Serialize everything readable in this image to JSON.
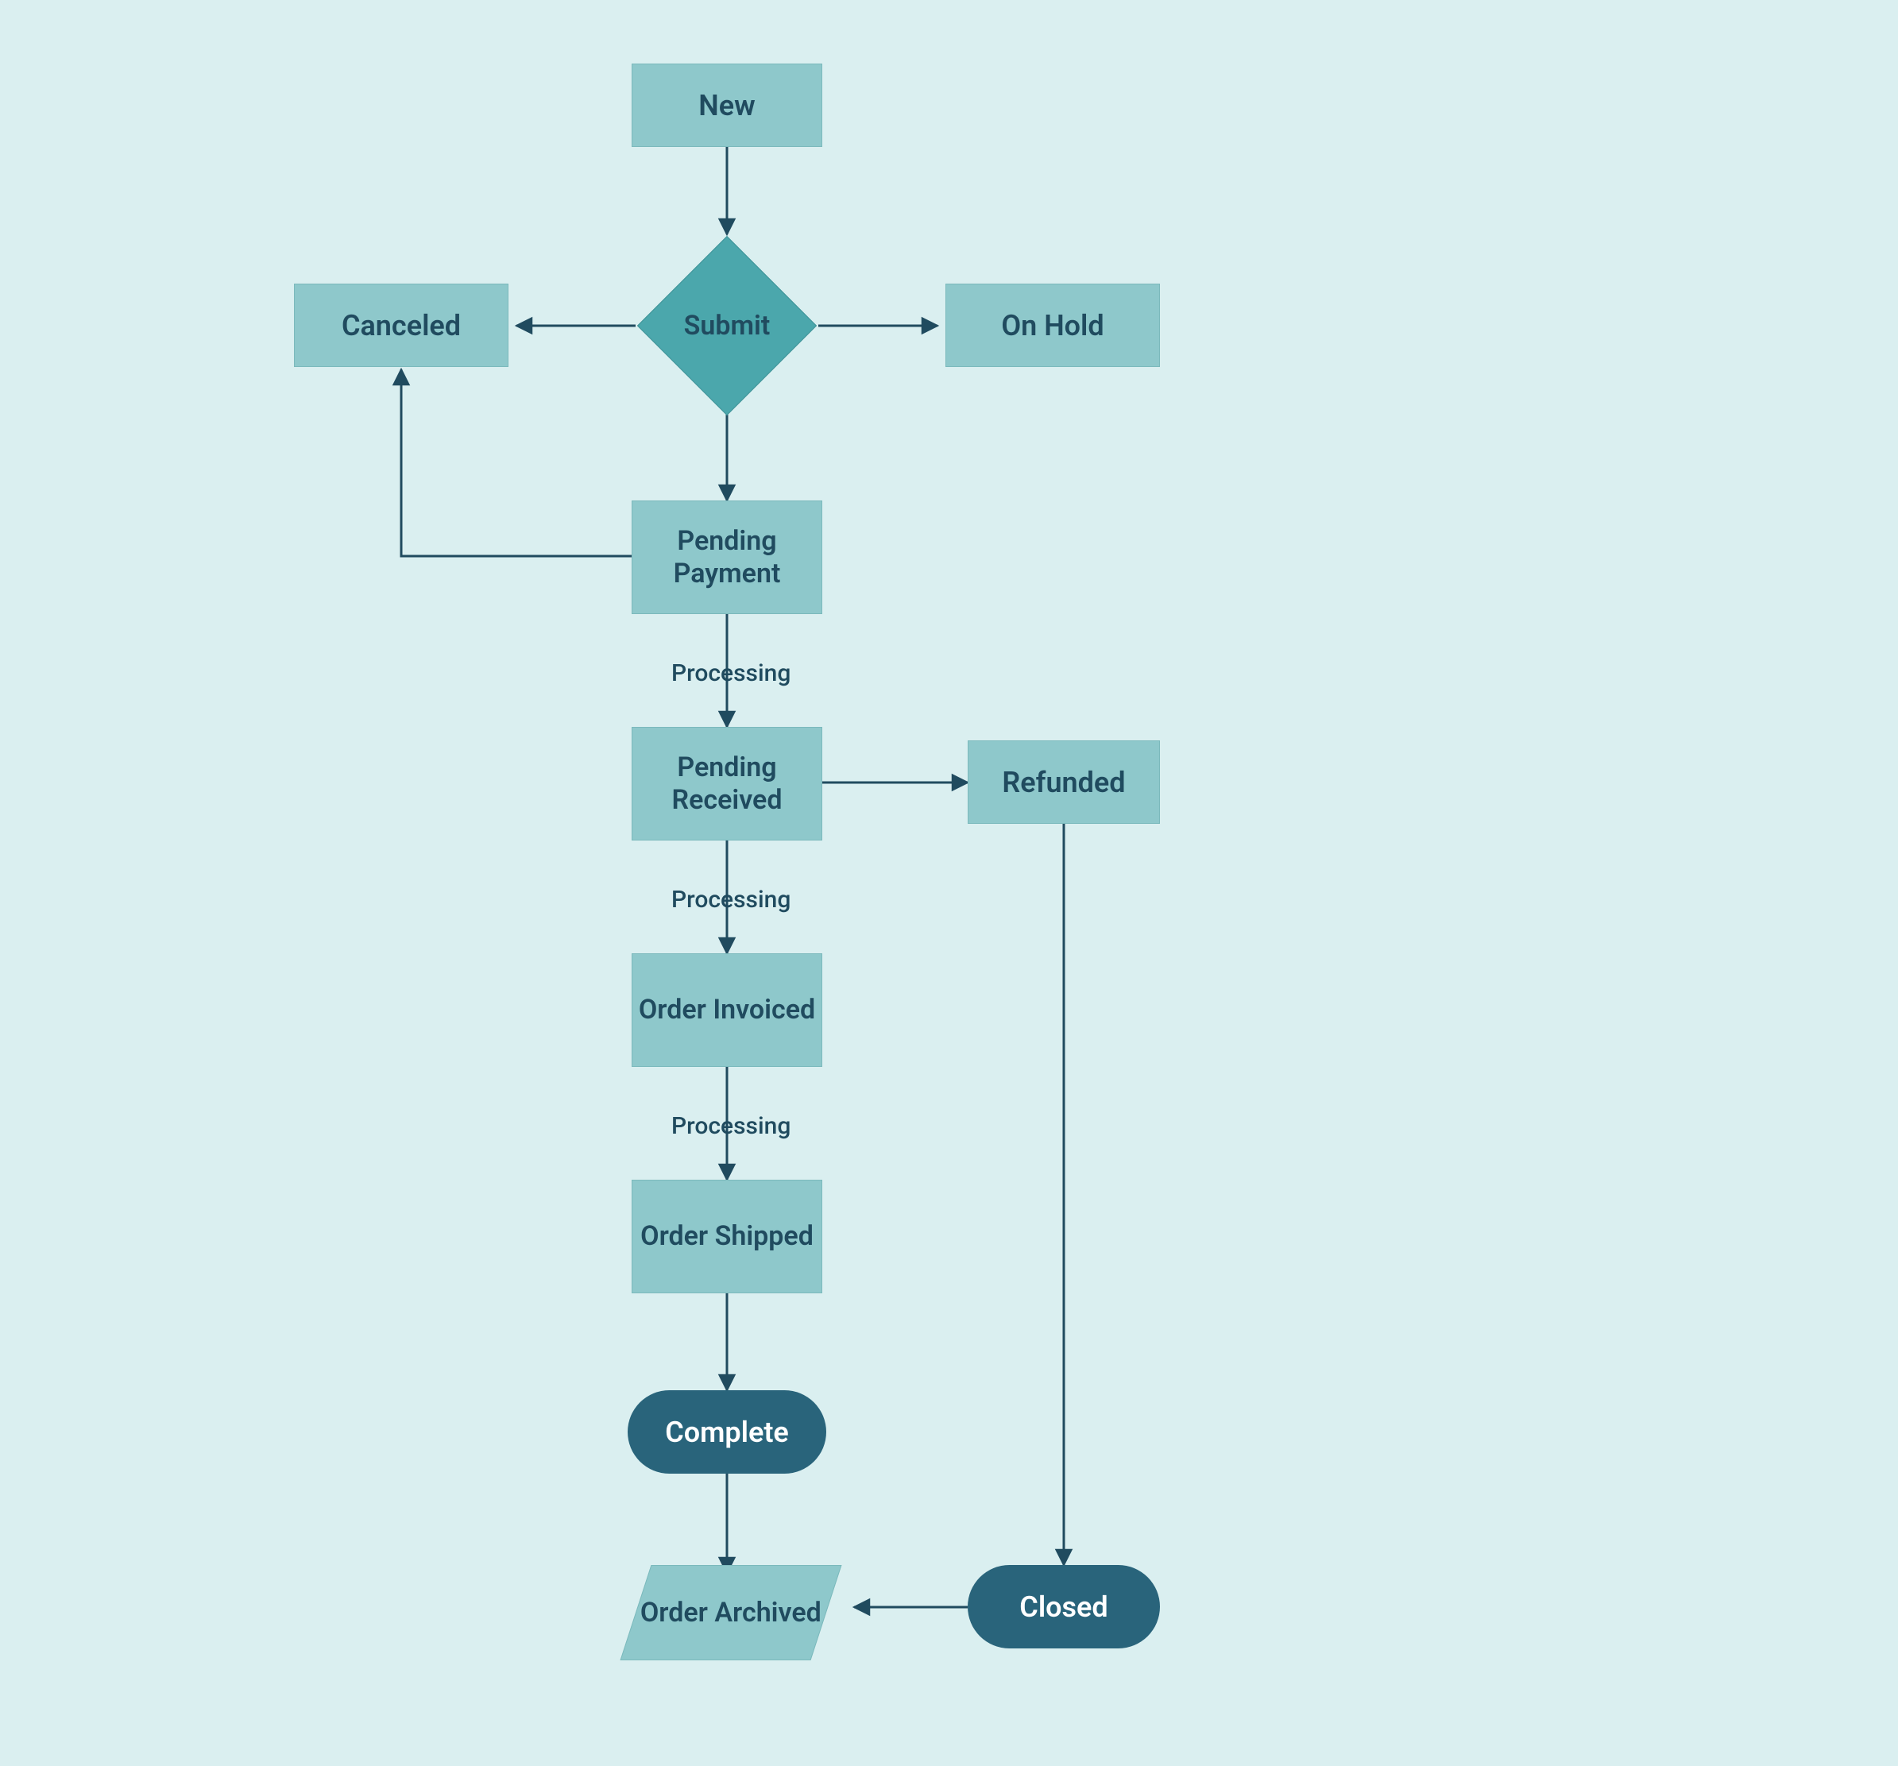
{
  "nodes": {
    "new": "New",
    "submit": "Submit",
    "canceled": "Canceled",
    "on_hold": "On Hold",
    "pending_payment": "Pending Payment",
    "pending_received": "Pending Received",
    "order_invoiced": "Order Invoiced",
    "order_shipped": "Order Shipped",
    "complete": "Complete",
    "refunded": "Refunded",
    "order_archived": "Order Archived",
    "closed": "Closed"
  },
  "edge_labels": {
    "processing1": "Processing",
    "processing2": "Processing",
    "processing3": "Processing"
  },
  "colors": {
    "background": "#daeff0",
    "node_light": "#8ec8cb",
    "node_decision": "#4ba7ac",
    "node_dark": "#29647b",
    "text_dark": "#204b5f",
    "text_light": "#ffffff",
    "stroke": "#204b5f"
  },
  "diagram": {
    "type": "flowchart",
    "shapes": {
      "new": "process",
      "submit": "decision",
      "canceled": "process",
      "on_hold": "process",
      "pending_payment": "process",
      "pending_received": "process",
      "order_invoiced": "process",
      "order_shipped": "process",
      "complete": "terminator",
      "refunded": "process",
      "order_archived": "data",
      "closed": "terminator"
    },
    "edges": [
      {
        "from": "new",
        "to": "submit"
      },
      {
        "from": "submit",
        "to": "canceled"
      },
      {
        "from": "submit",
        "to": "on_hold"
      },
      {
        "from": "submit",
        "to": "pending_payment"
      },
      {
        "from": "pending_payment",
        "to": "canceled"
      },
      {
        "from": "pending_payment",
        "to": "pending_received",
        "label": "Processing"
      },
      {
        "from": "pending_received",
        "to": "refunded"
      },
      {
        "from": "pending_received",
        "to": "order_invoiced",
        "label": "Processing"
      },
      {
        "from": "order_invoiced",
        "to": "order_shipped",
        "label": "Processing"
      },
      {
        "from": "order_shipped",
        "to": "complete"
      },
      {
        "from": "complete",
        "to": "order_archived"
      },
      {
        "from": "refunded",
        "to": "closed"
      },
      {
        "from": "closed",
        "to": "order_archived"
      }
    ]
  }
}
